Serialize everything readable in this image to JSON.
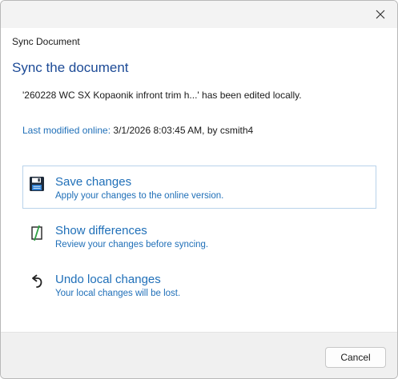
{
  "dialog": {
    "title": "Sync Document",
    "heading": "Sync the document",
    "message": "'260228 WC SX Kopaonik infront trim h...' has been edited locally.",
    "last_modified": {
      "label": "Last modified online:",
      "value": "3/1/2026 8:03:45 AM, by csmith4"
    }
  },
  "options": [
    {
      "icon": "floppy-disk-icon",
      "title": "Save changes",
      "description": "Apply your changes to the online version."
    },
    {
      "icon": "compare-differences-icon",
      "title": "Show differences",
      "description": "Review your changes before syncing."
    },
    {
      "icon": "undo-arrow-icon",
      "title": "Undo local changes",
      "description": "Your local changes will be lost."
    }
  ],
  "footer": {
    "cancel_label": "Cancel"
  },
  "colors": {
    "heading": "#1c4a96",
    "link": "#1f6fb8",
    "selected_border": "#b9d3ea",
    "footer_bg": "#f0f0f0"
  }
}
